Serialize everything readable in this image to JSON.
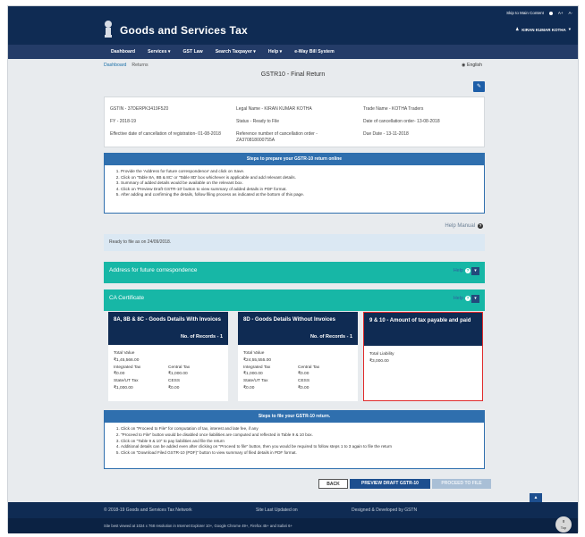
{
  "top_links": {
    "skip": "Skip to Main Content",
    "a_plus": "A+",
    "a_minus": "A-"
  },
  "brand": "Goods and Services Tax",
  "user": "KIRAN KUMAR KOTHA",
  "nav": [
    "Dashboard",
    "Services ▾",
    "GST Law",
    "Search Taxpayer ▾",
    "Help ▾",
    "e-Way Bill System"
  ],
  "breadcrumb": {
    "home": "Dashboard",
    "current": "Returns"
  },
  "language": "English",
  "page_title": "GSTR10 - Final Return",
  "info": {
    "gstin": "GSTIN - 37DERPK3419F5Z0",
    "legal_name": "Legal Name - KIRAN KUMAR KOTHA",
    "trade_name": "Trade Name - KOTHA Traders",
    "fy": "FY - 2018-19",
    "status": "Status - Ready to File",
    "date_cancel": "Date of cancellation order- 13-08-2018",
    "effective_date": "Effective date of cancellation of registration- 01-08-2018",
    "ref_number": "Reference number of cancellation order - ZA370818000755A",
    "due_date": "Due Date - 13-11-2018"
  },
  "steps_prepare": {
    "header": "Steps to prepare your GSTR-10 return online",
    "items": [
      "Provide the 'Address for future correspondence' and click on Save.",
      "Click on 'Table 8A, 8B & 8C' or 'Table 8D' box whichever is applicable and add relevant details.",
      "Summary of added details would be available on the relevant box.",
      "Click on 'Preview Draft GSTR-10' button to view summary of added details in PDF format.",
      "After adding and confirming the details, follow filing  process as indicated at the bottom of this page."
    ]
  },
  "help_manual": "Help Manual",
  "ready_text": "Ready to file as on 24/09/2018.",
  "sections": {
    "address": {
      "label": "Address for future correspondence",
      "help": "Help"
    },
    "ca": {
      "label": "CA Certificate",
      "help": "Help"
    }
  },
  "tiles": [
    {
      "title": "8A, 8B & 8C - Goods Details With Invoices",
      "records": "No. of Records - 1",
      "total_label": "Total Value",
      "total": "₹1,45,566.00",
      "f1l": "Integrated Tax",
      "f1v": "₹0.00",
      "f2l": "Central Tax",
      "f2v": "₹1,000.00",
      "f3l": "State/UT Tax",
      "f3v": "₹1,000.00",
      "f4l": "CESS",
      "f4v": "₹0.00"
    },
    {
      "title": "8D - Goods Details Without Invoices",
      "records": "No. of Records - 1",
      "total_label": "Total Value",
      "total": "₹24,55,555.00",
      "f1l": "Integrated Tax",
      "f1v": "₹1,000.00",
      "f2l": "Central Tax",
      "f2v": "₹0.00",
      "f3l": "State/UT Tax",
      "f3v": "₹0.00",
      "f4l": "CESS",
      "f4v": "₹0.00"
    },
    {
      "title": "9 & 10 - Amount of tax payable and paid",
      "total_label": "Total Liability",
      "total": "₹3,000.00"
    }
  ],
  "steps_file": {
    "header": "Steps to file your GSTR-10 return.",
    "items": [
      "Click on \"Proceed to File\" for computation of tax, interest and late fee, if any",
      "\"Proceed to File\" button would be disabled once liabilities are computed and reflected in Table 9 & 10 box.",
      "Click on \"Table 9 & 10\" to pay liabilities and file the return",
      "Additional details can be added even after clicking on \"Proceed to file\" button, then you would be required to follow steps 1 to 3 again to file the return",
      "Click on \"Download Filed GSTR-10 (PDF)\" button to view summary of filed details in PDF format."
    ]
  },
  "buttons": {
    "back": "BACK",
    "preview": "PREVIEW DRAFT GSTR-10",
    "proceed": "PROCEED TO FILE"
  },
  "footer": {
    "copyright": "© 2018-19 Goods and Services Tax Network",
    "updated": "Site Last Updated on",
    "developed": "Designed & Developed by GSTN",
    "best_viewed": "Site best viewed at 1024 x 768 resolution in Internet Explorer 10+, Google Chrome 49+, Firefox 45+ and Safari 6+",
    "top": "Top"
  }
}
